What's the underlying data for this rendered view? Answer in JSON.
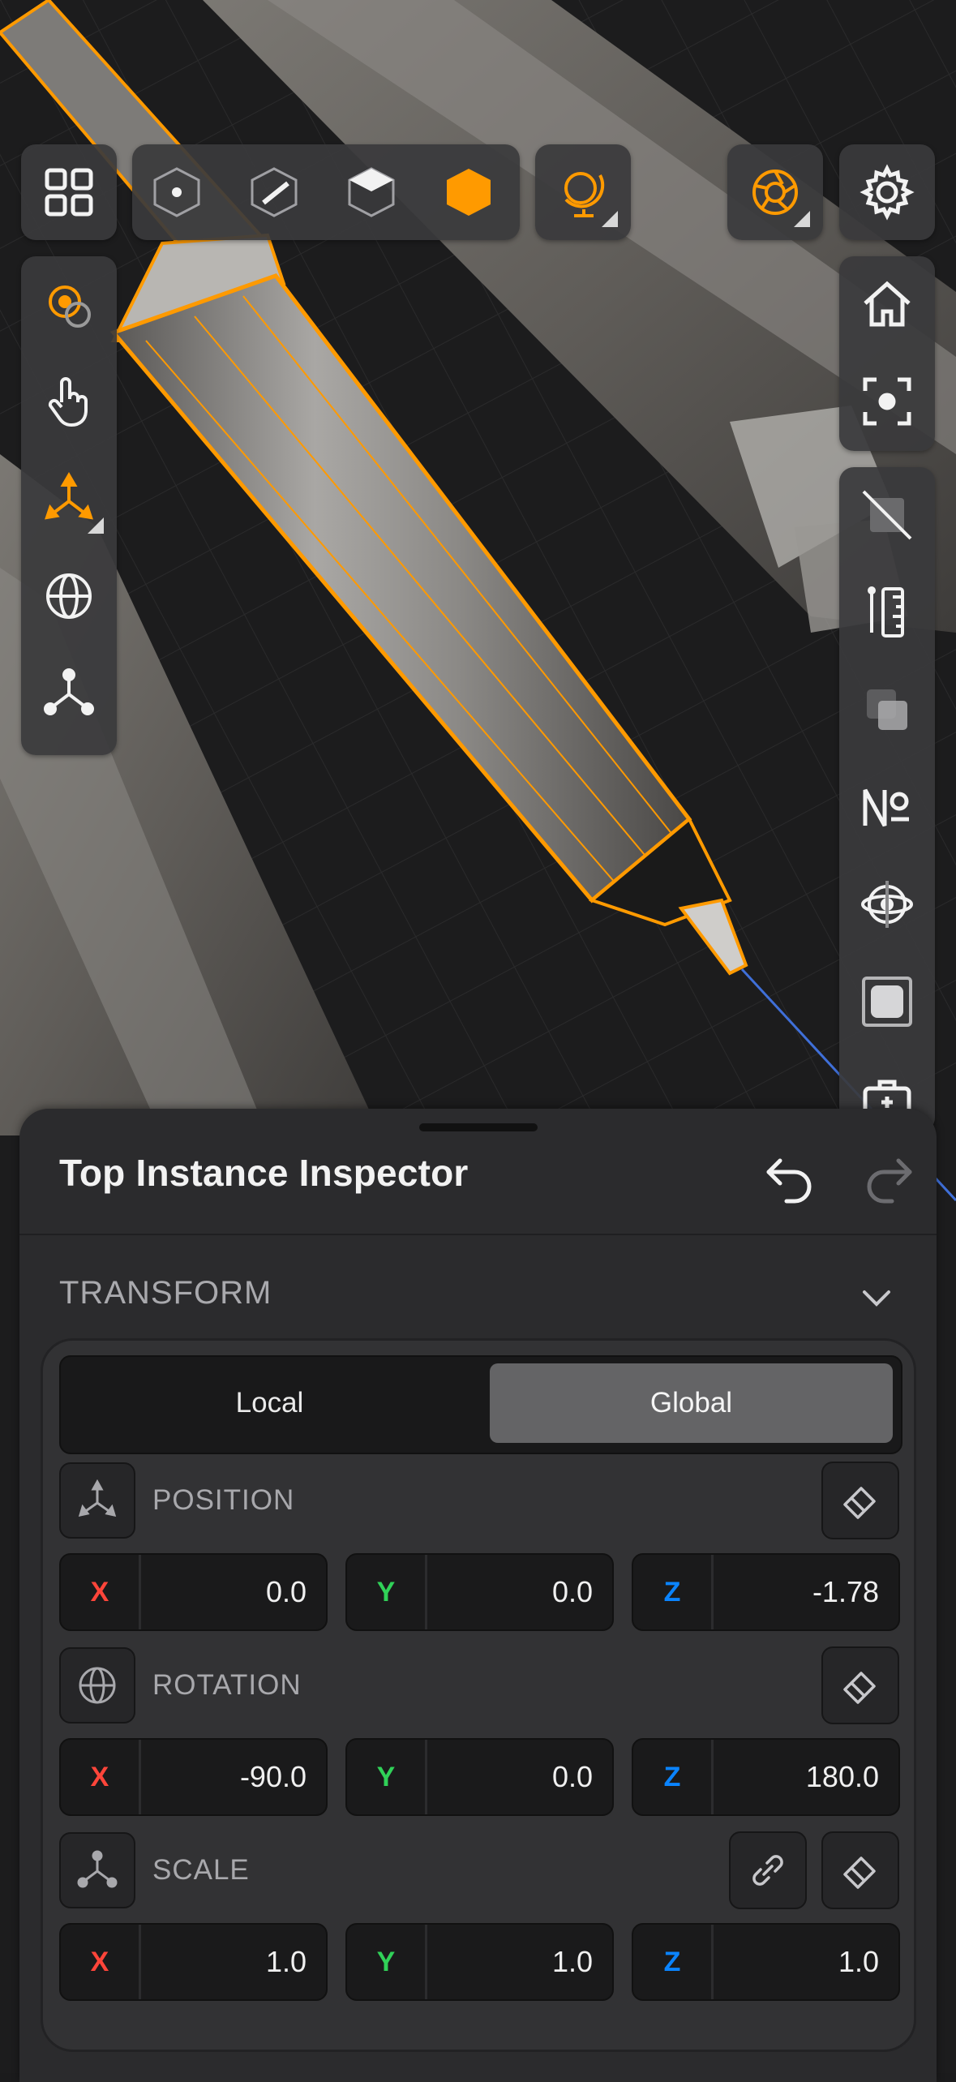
{
  "colors": {
    "accent": "#FF9A00",
    "x_axis": "#FF453A",
    "y_axis": "#30D158",
    "z_axis": "#0A84FF"
  },
  "top_toolbar": {
    "left_group": [
      "grid-icon"
    ],
    "mode_group": [
      "vertex-mode-icon",
      "edge-mode-icon",
      "face-mode-icon",
      "object-mode-icon"
    ],
    "extra": [
      "world-globe-icon"
    ],
    "right": [
      "camera-aperture-icon",
      "settings-gear-icon"
    ]
  },
  "left_toolbar": [
    "pivot-target-icon",
    "touch-hand-icon",
    "move-axes-icon",
    "rotate-sphere-icon",
    "scale-nodes-icon"
  ],
  "right_toolbar": [
    "home-icon",
    "focus-frame-icon",
    "hide-overlay-icon",
    "measure-ruler-icon",
    "stack-layers-icon",
    "numbering-icon",
    "orbit-target-icon",
    "square-shape-icon",
    "toolbox-icon"
  ],
  "inspector": {
    "title": "Top Instance Inspector",
    "section_title": "TRANSFORM",
    "space_options": {
      "local": "Local",
      "global": "Global",
      "selected": "Global"
    },
    "position": {
      "label": "POSITION",
      "x": "0.0",
      "y": "0.0",
      "z": "-1.78"
    },
    "rotation": {
      "label": "ROTATION",
      "x": "-90.0",
      "y": "0.0",
      "z": "180.0"
    },
    "scale": {
      "label": "SCALE",
      "x": "1.0",
      "y": "1.0",
      "z": "1.0"
    },
    "axis_labels": {
      "x": "X",
      "y": "Y",
      "z": "Z"
    }
  }
}
